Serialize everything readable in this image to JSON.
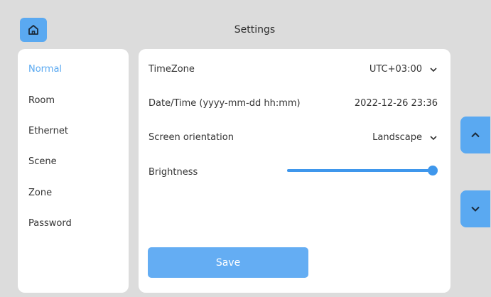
{
  "header": {
    "title": "Settings",
    "home_icon": "home-icon"
  },
  "colors": {
    "accent": "#5aa9f1",
    "background": "#dcdcdc",
    "panel": "#ffffff"
  },
  "sidebar": {
    "items": [
      {
        "label": "Normal",
        "active": true
      },
      {
        "label": "Room",
        "active": false
      },
      {
        "label": "Ethernet",
        "active": false
      },
      {
        "label": "Scene",
        "active": false
      },
      {
        "label": "Zone",
        "active": false
      },
      {
        "label": "Password",
        "active": false
      }
    ]
  },
  "settings": {
    "timezone": {
      "label": "TimeZone",
      "value": "UTC+03:00",
      "icon": "chevron-down-icon"
    },
    "datetime": {
      "label": "Date/Time (yyyy-mm-dd hh:mm)",
      "value": "2022-12-26 23:36"
    },
    "orientation": {
      "label": "Screen orientation",
      "value": "Landscape",
      "icon": "chevron-down-icon"
    },
    "brightness": {
      "label": "Brightness",
      "level_percent": 100
    }
  },
  "actions": {
    "save_label": "Save"
  },
  "scroll": {
    "up_icon": "chevron-up-icon",
    "down_icon": "chevron-down-icon"
  }
}
